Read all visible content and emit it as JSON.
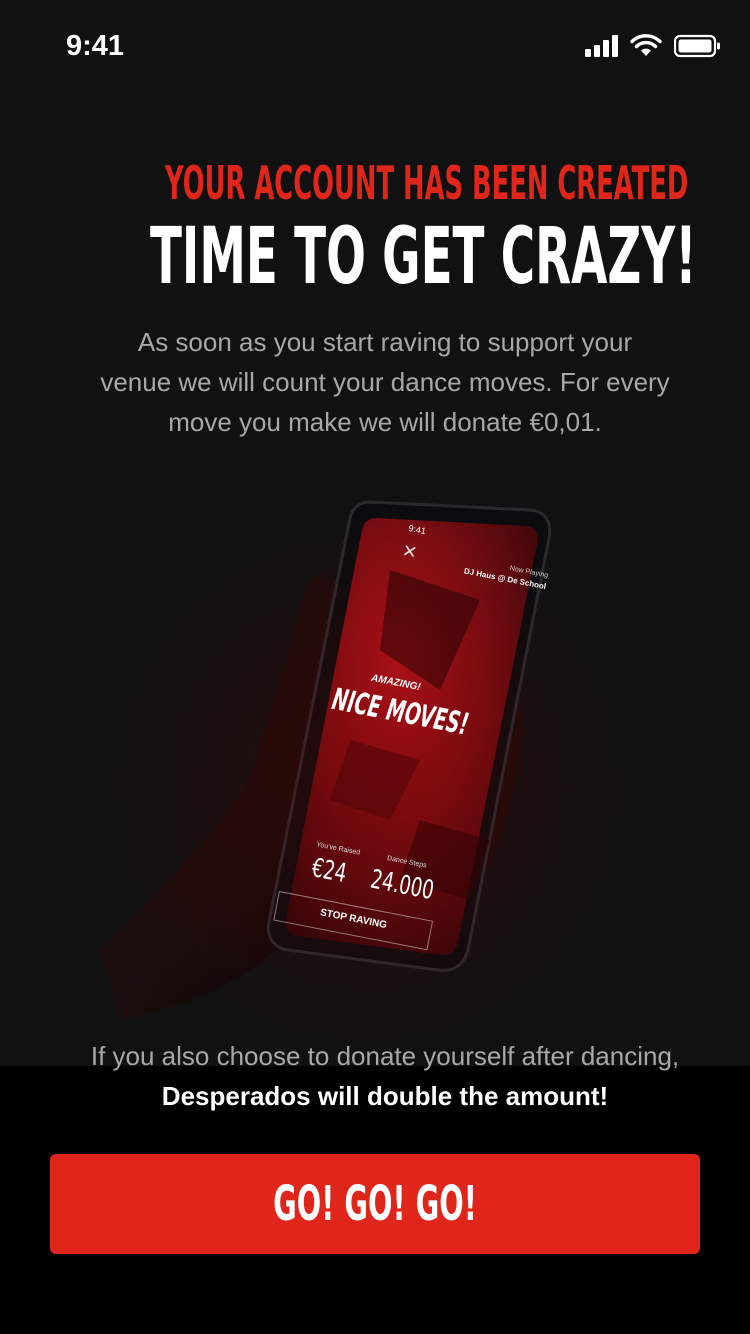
{
  "status_bar": {
    "time": "9:41",
    "icons": [
      "signal-icon",
      "wifi-icon",
      "battery-icon"
    ]
  },
  "header": {
    "eyebrow": "YOUR ACCOUNT HAS BEEN CREATED",
    "headline": "TIME TO GET CRAZY!"
  },
  "intro": {
    "text": "As soon as you start raving to support your venue we will count your dance moves. For every move you make we will donate €0,01."
  },
  "phone_preview": {
    "time": "9:41",
    "now_playing_label": "Now Playing",
    "now_playing_value": "DJ Haus @ De School",
    "amazing_label": "AMAZING!",
    "nice_moves_label": "NICE MOVES!",
    "raised_label": "You've Raised",
    "raised_value": "€24",
    "steps_label": "Dance Steps",
    "steps_value": "24.000",
    "stop_label": "STOP RAVING"
  },
  "donate": {
    "text_plain": "If you also choose to donate yourself after dancing, ",
    "text_bold": "Desperados will double the amount!"
  },
  "cta": {
    "label": "GO! GO! GO!"
  },
  "colors": {
    "accent": "#e0261a",
    "background": "#111111",
    "muted_text": "#a8a8a8"
  }
}
